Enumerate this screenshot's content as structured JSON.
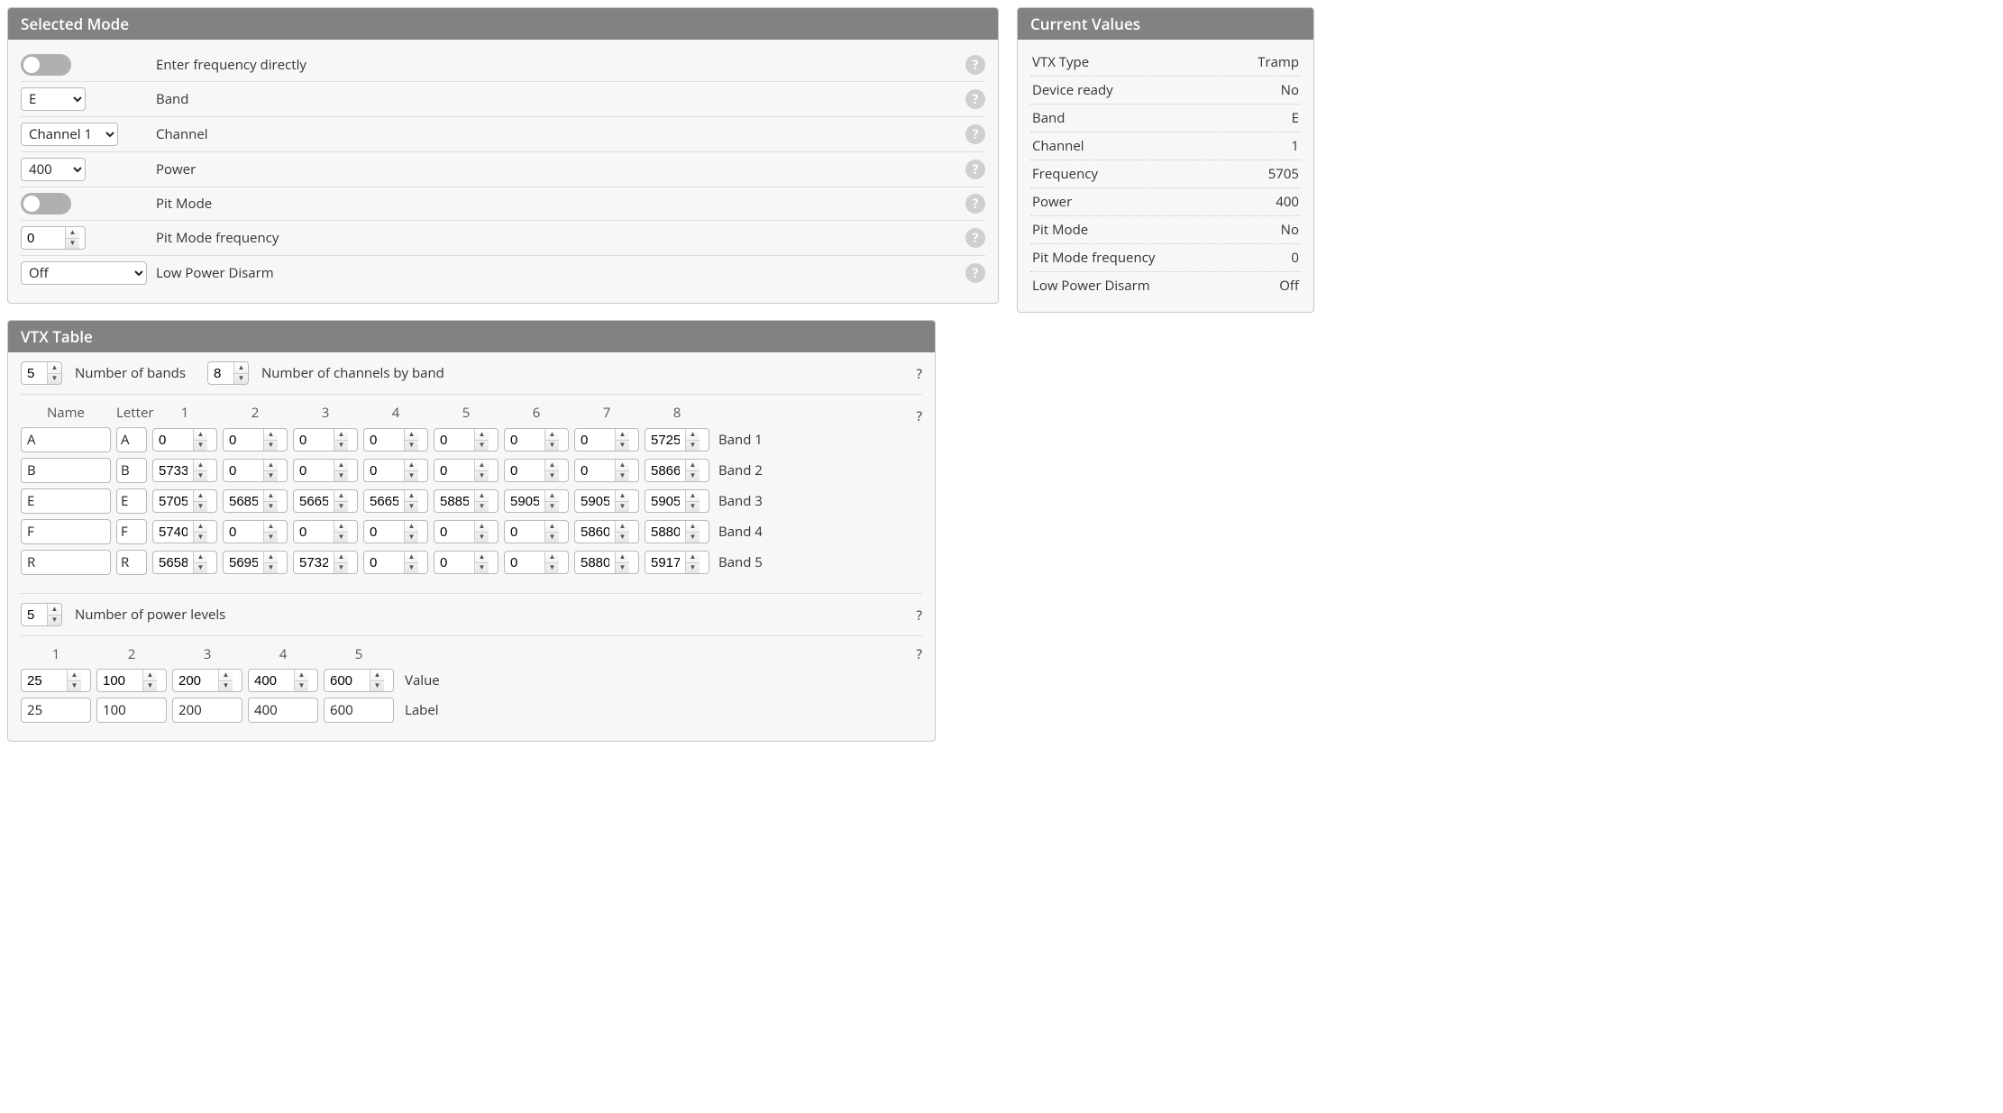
{
  "selectedMode": {
    "title": "Selected Mode",
    "rows": {
      "enterFreqDirectly": "Enter frequency directly",
      "band": {
        "label": "Band",
        "value": "E"
      },
      "channel": {
        "label": "Channel",
        "value": "Channel 1"
      },
      "power": {
        "label": "Power",
        "value": "400"
      },
      "pitMode": "Pit Mode",
      "pitModeFreq": {
        "label": "Pit Mode frequency",
        "value": "0"
      },
      "lowPowerDisarm": {
        "label": "Low Power Disarm",
        "value": "Off"
      }
    }
  },
  "vtxTable": {
    "title": "VTX Table",
    "numBands": {
      "value": "5",
      "label": "Number of bands"
    },
    "numChannels": {
      "value": "8",
      "label": "Number of channels by band"
    },
    "headers": {
      "name": "Name",
      "letter": "Letter",
      "ch": [
        "1",
        "2",
        "3",
        "4",
        "5",
        "6",
        "7",
        "8"
      ]
    },
    "bands": [
      {
        "name": "A",
        "letter": "A",
        "ch": [
          "0",
          "0",
          "0",
          "0",
          "0",
          "0",
          "0",
          "5725"
        ],
        "label": "Band 1"
      },
      {
        "name": "B",
        "letter": "B",
        "ch": [
          "5733",
          "0",
          "0",
          "0",
          "0",
          "0",
          "0",
          "5866"
        ],
        "label": "Band 2"
      },
      {
        "name": "E",
        "letter": "E",
        "ch": [
          "5705",
          "5685",
          "5665",
          "5665",
          "5885",
          "5905",
          "5905",
          "5905"
        ],
        "label": "Band 3"
      },
      {
        "name": "F",
        "letter": "F",
        "ch": [
          "5740",
          "0",
          "0",
          "0",
          "0",
          "0",
          "5860",
          "5880"
        ],
        "label": "Band 4"
      },
      {
        "name": "R",
        "letter": "R",
        "ch": [
          "5658",
          "5695",
          "5732",
          "0",
          "0",
          "0",
          "5880",
          "5917"
        ],
        "label": "Band 5"
      }
    ],
    "numPowerLevels": {
      "value": "5",
      "label": "Number of power levels"
    },
    "powerHeaders": [
      "1",
      "2",
      "3",
      "4",
      "5"
    ],
    "powerValues": [
      "25",
      "100",
      "200",
      "400",
      "600"
    ],
    "powerLabels": [
      "25",
      "100",
      "200",
      "400",
      "600"
    ],
    "valueLabel": "Value",
    "labelLabel": "Label"
  },
  "currentValues": {
    "title": "Current Values",
    "rows": [
      {
        "k": "VTX Type",
        "v": "Tramp"
      },
      {
        "k": "Device ready",
        "v": "No"
      },
      {
        "k": "Band",
        "v": "E"
      },
      {
        "k": "Channel",
        "v": "1"
      },
      {
        "k": "Frequency",
        "v": "5705"
      },
      {
        "k": "Power",
        "v": "400"
      },
      {
        "k": "Pit Mode",
        "v": "No"
      },
      {
        "k": "Pit Mode frequency",
        "v": "0"
      },
      {
        "k": "Low Power Disarm",
        "v": "Off"
      }
    ]
  }
}
